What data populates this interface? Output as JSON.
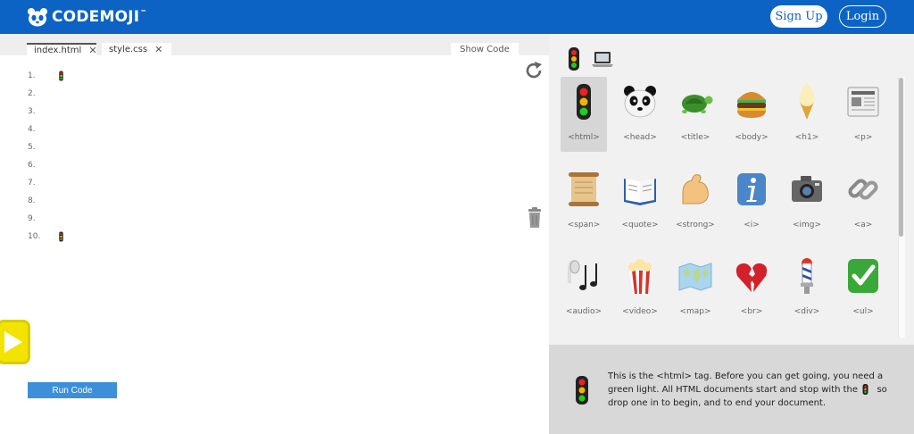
{
  "header": {
    "brand": "CODEMOJI",
    "brand_tm": "™",
    "signup_label": "Sign Up",
    "login_label": "Login"
  },
  "editor": {
    "tabs": [
      {
        "label": "index.html",
        "close": "✕"
      },
      {
        "label": "style.css",
        "close": "✕"
      }
    ],
    "show_code_label": "Show Code",
    "lines": [
      {
        "num": "1.",
        "emoji": "traffic-light-icon"
      },
      {
        "num": "2."
      },
      {
        "num": "3."
      },
      {
        "num": "4."
      },
      {
        "num": "5."
      },
      {
        "num": "6."
      },
      {
        "num": "7."
      },
      {
        "num": "8."
      },
      {
        "num": "9."
      },
      {
        "num": "10.",
        "emoji": "traffic-light-icon"
      }
    ],
    "run_label": "Run Code"
  },
  "palette": {
    "categories": [
      "traffic-light-icon",
      "laptop-icon"
    ],
    "items": [
      {
        "label": "<html>",
        "icon": "traffic-light-icon",
        "selected": true
      },
      {
        "label": "<head>",
        "icon": "panda-icon"
      },
      {
        "label": "<title>",
        "icon": "turtle-icon"
      },
      {
        "label": "<body>",
        "icon": "hamburger-icon"
      },
      {
        "label": "<h1>",
        "icon": "ice-cream-icon"
      },
      {
        "label": "<p>",
        "icon": "newspaper-icon"
      },
      {
        "label": "<span>",
        "icon": "scroll-icon"
      },
      {
        "label": "<quote>",
        "icon": "open-book-icon"
      },
      {
        "label": "<strong>",
        "icon": "flexed-bicep-icon"
      },
      {
        "label": "<i>",
        "icon": "information-icon"
      },
      {
        "label": "<img>",
        "icon": "camera-icon"
      },
      {
        "label": "<a>",
        "icon": "link-icon"
      },
      {
        "label": "<audio>",
        "icon": "headphones-icon"
      },
      {
        "label": "<video>",
        "icon": "popcorn-icon"
      },
      {
        "label": "<map>",
        "icon": "world-map-icon"
      },
      {
        "label": "<br>",
        "icon": "broken-heart-icon"
      },
      {
        "label": "<div>",
        "icon": "barber-pole-icon"
      },
      {
        "label": "<ul>",
        "icon": "check-mark-icon"
      }
    ]
  },
  "info": {
    "text_1": "This is the <html> tag. Before you can get going, you need a green light. All HTML documents start and stop with the",
    "text_2": "so drop one in to begin, and to end your document."
  },
  "colors": {
    "header_bg": "#0c63c4",
    "run_button": "#3d8fd9",
    "play_button": "#f2e400"
  }
}
